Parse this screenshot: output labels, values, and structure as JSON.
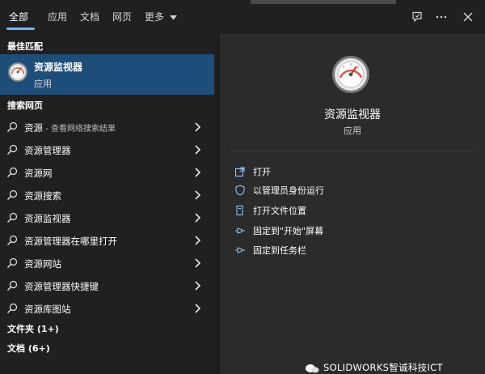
{
  "tabs": [
    {
      "label": "全部",
      "active": true
    },
    {
      "label": "应用",
      "active": false
    },
    {
      "label": "文档",
      "active": false
    },
    {
      "label": "网页",
      "active": false
    },
    {
      "label": "更多",
      "active": false
    }
  ],
  "top_icons": [
    "feedback-icon",
    "more-icon",
    "close-icon"
  ],
  "accent_color": "#6cb8f6",
  "selection_color": "#1d4e7a",
  "best_match": {
    "section_label": "最佳匹配",
    "name": "资源监视器",
    "type": "应用"
  },
  "web_search": {
    "section_label": "搜索网页",
    "items": [
      {
        "text": "资源",
        "suffix": " - 查看网络搜索结果"
      },
      {
        "text": "资源管理器",
        "suffix": ""
      },
      {
        "text": "资源网",
        "suffix": ""
      },
      {
        "text": "资源搜索",
        "suffix": ""
      },
      {
        "text": "资源监视器",
        "suffix": ""
      },
      {
        "text": "资源管理器在哪里打开",
        "suffix": ""
      },
      {
        "text": "资源网站",
        "suffix": ""
      },
      {
        "text": "资源管理器快捷键",
        "suffix": ""
      },
      {
        "text": "资源库图站",
        "suffix": ""
      }
    ]
  },
  "folders_label": "文件夹 (1+)",
  "documents_label": "文档 (6+)",
  "detail": {
    "name": "资源监视器",
    "type": "应用",
    "actions": [
      {
        "label": "打开",
        "icon": "open-icon"
      },
      {
        "label": "以管理员身份运行",
        "icon": "shield-icon"
      },
      {
        "label": "打开文件位置",
        "icon": "folder-location-icon"
      },
      {
        "label": "固定到\"开始\"屏幕",
        "icon": "pin-icon"
      },
      {
        "label": "固定到任务栏",
        "icon": "pin-icon"
      }
    ]
  },
  "watermark": "SOLIDWORKS智诚科技ICT"
}
